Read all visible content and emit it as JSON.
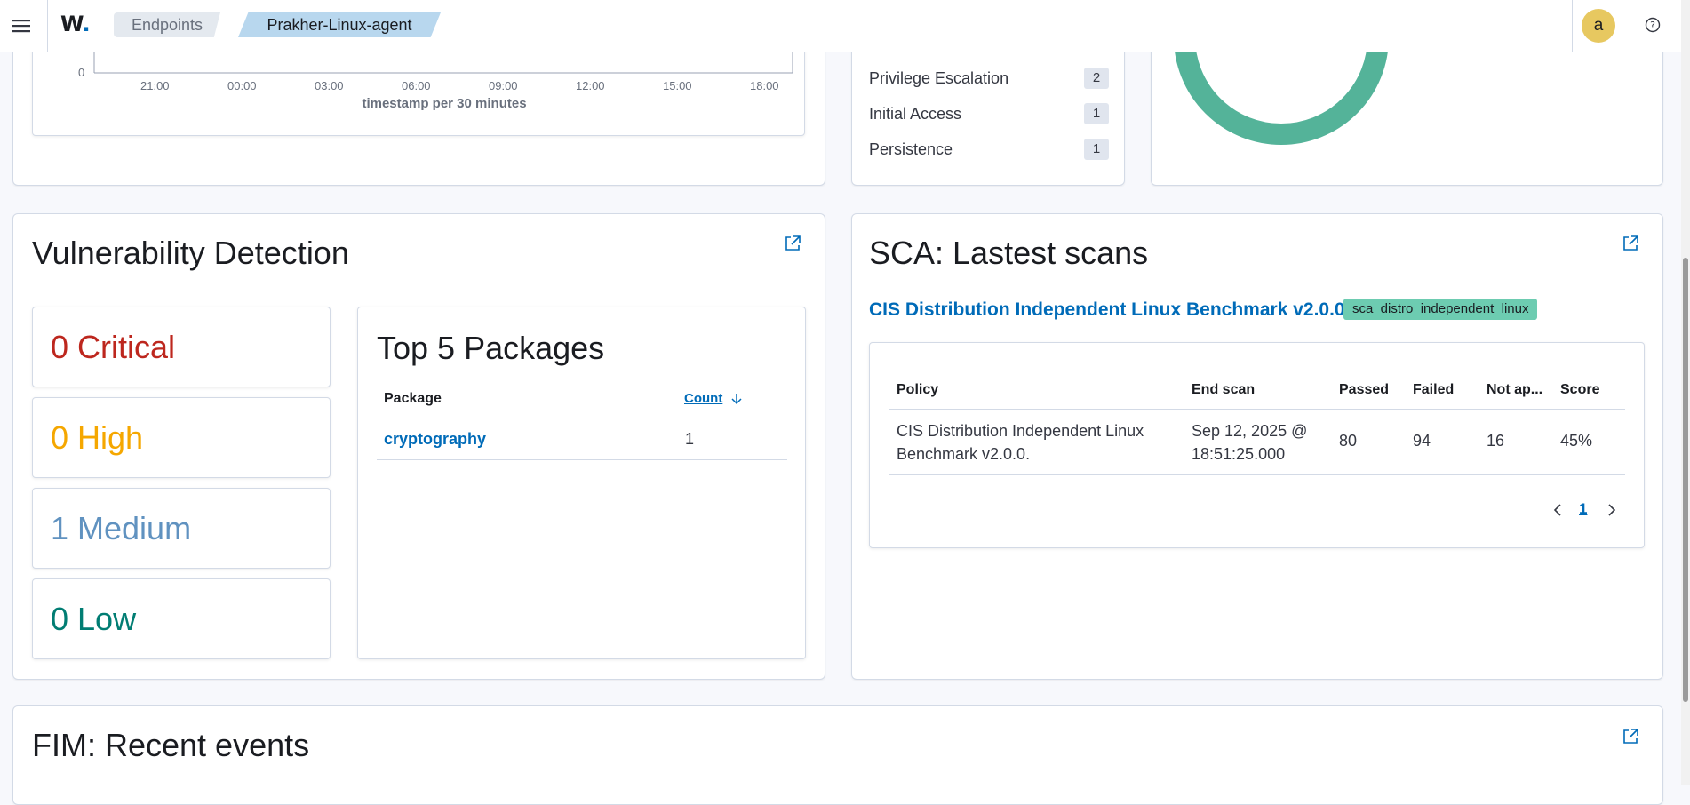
{
  "topbar": {
    "logo_letter": "W",
    "logo_dot": ".",
    "breadcrumbs": [
      "Endpoints",
      "Prakher-Linux-agent"
    ],
    "avatar_letter": "a"
  },
  "events_chart": {
    "y_zero": "0",
    "x_ticks": [
      "21:00",
      "00:00",
      "03:00",
      "06:00",
      "09:00",
      "12:00",
      "15:00",
      "18:00"
    ],
    "x_label": "timestamp per 30 minutes"
  },
  "mitre_tactics": [
    {
      "label": "Privilege Escalation",
      "count": "2"
    },
    {
      "label": "Initial Access",
      "count": "1"
    },
    {
      "label": "Persistence",
      "count": "1"
    }
  ],
  "colors": {
    "accent": "#006bb8",
    "donut": "#54b399",
    "critical": "#bd271e",
    "high": "#f5a700",
    "medium": "#6092c0",
    "low": "#017d73",
    "badge": "#6dccb1"
  },
  "vulnerability": {
    "title": "Vulnerability Detection",
    "severities": [
      {
        "label": "0 Critical"
      },
      {
        "label": "0 High"
      },
      {
        "label": "1 Medium"
      },
      {
        "label": "0 Low"
      }
    ],
    "top_packages": {
      "title": "Top 5 Packages",
      "col_package": "Package",
      "col_count": "Count",
      "rows": [
        {
          "package": "cryptography",
          "count": "1"
        }
      ]
    }
  },
  "sca": {
    "title": "SCA: Lastest scans",
    "policy_link": "CIS Distribution Independent Linux Benchmark v2.0.0.",
    "policy_id": "sca_distro_independent_linux",
    "columns": [
      "Policy",
      "End scan",
      "Passed",
      "Failed",
      "Not ap...",
      "Score"
    ],
    "row": {
      "policy": "CIS Distribution Independent Linux Benchmark v2.0.0.",
      "end_scan": "Sep 12, 2025 @ 18:51:25.000",
      "passed": "80",
      "failed": "94",
      "not_applicable": "16",
      "score": "45%"
    },
    "page": "1"
  },
  "fim": {
    "title": "FIM: Recent events"
  },
  "icons": [
    "menu-icon",
    "help-icon",
    "external-link-icon",
    "arrow-down-icon",
    "chevron-left-icon",
    "chevron-right-icon"
  ]
}
